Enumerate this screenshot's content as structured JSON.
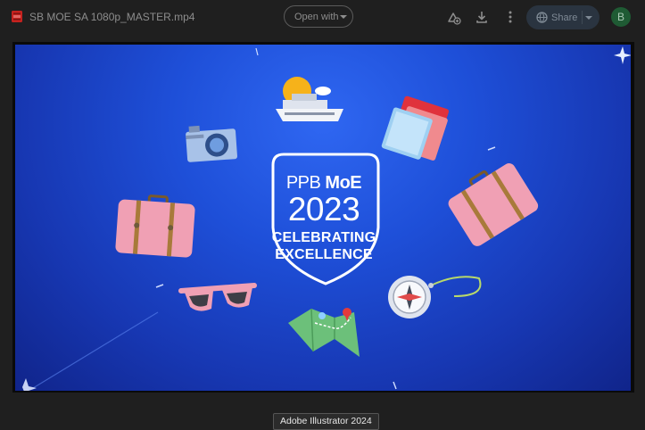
{
  "header": {
    "file_name": "SB MOE SA 1080p_MASTER.mp4",
    "open_with_label": "Open with",
    "share_label": "Share",
    "avatar_initial": "B"
  },
  "video": {
    "logo_line1_light": "PPB ",
    "logo_line1_bold": "MoE",
    "logo_year": "2023",
    "logo_line3": "CELEBRATING",
    "logo_line4": "EXCELLENCE"
  },
  "tooltip": {
    "text": "Adobe Illustrator 2024"
  },
  "colors": {
    "background": "#1f1f1f",
    "video_blue": "#1e4fd8",
    "share_bg": "#2a3440",
    "avatar_bg": "#1f5b34"
  },
  "icons": [
    "video-file-icon",
    "add-to-drive-icon",
    "download-icon",
    "more-vert-icon",
    "globe-icon"
  ]
}
